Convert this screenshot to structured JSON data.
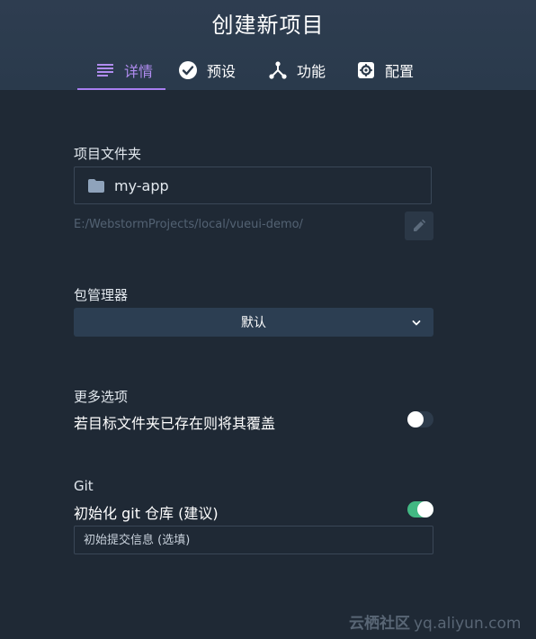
{
  "window": {
    "title": "创建新项目"
  },
  "tabs": [
    {
      "label": "详情",
      "icon": "list-icon",
      "active": true
    },
    {
      "label": "预设",
      "icon": "check-circle-icon",
      "active": false
    },
    {
      "label": "功能",
      "icon": "fork-icon",
      "active": false
    },
    {
      "label": "配置",
      "icon": "gear-icon",
      "active": false
    }
  ],
  "project_folder": {
    "label": "项目文件夹",
    "name": "my-app",
    "path": "E:/WebstormProjects/local/vueui-demo/",
    "icon": "folder-icon"
  },
  "package_manager": {
    "label": "包管理器",
    "selected": "默认"
  },
  "more_options": {
    "label": "更多选项",
    "overwrite_label": "若目标文件夹已存在则将其覆盖",
    "overwrite_enabled": false
  },
  "git": {
    "label": "Git",
    "init_label": "初始化 git 仓库 (建议)",
    "init_enabled": true,
    "commit_placeholder": "初始提交信息 (选填)"
  },
  "watermark": {
    "brand": "云栖社区",
    "domain": "yq.aliyun.com"
  },
  "colors": {
    "accent": "#a77ef0",
    "toggle_on": "#42b883",
    "background": "#1f2935",
    "header": "#2c3b4d"
  }
}
